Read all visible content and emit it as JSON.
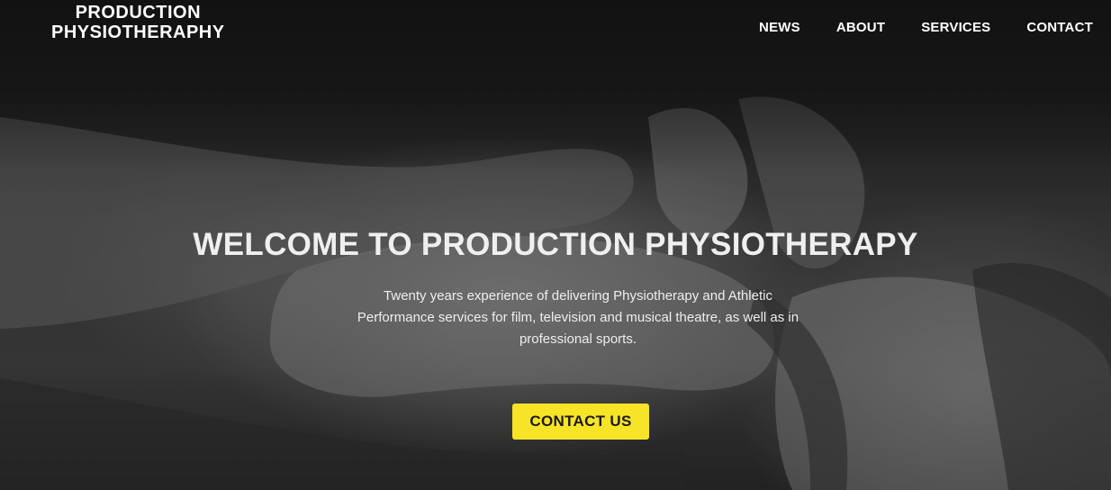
{
  "header": {
    "logo_line1": "PRODUCTION",
    "logo_line2": "PHYSIOTHERAPHY",
    "nav": [
      {
        "label": "NEWS"
      },
      {
        "label": "ABOUT"
      },
      {
        "label": "SERVICES"
      },
      {
        "label": "CONTACT"
      }
    ]
  },
  "hero": {
    "title": "WELCOME TO PRODUCTION PHYSIOTHERAPY",
    "description": "Twenty years experience of delivering Physiotherapy and Athletic Performance services for film, television and musical theatre, as well as in professional sports.",
    "cta_label": "CONTACT US"
  },
  "colors": {
    "cta_background": "#f7e427",
    "header_background": "#1b1b1b"
  }
}
